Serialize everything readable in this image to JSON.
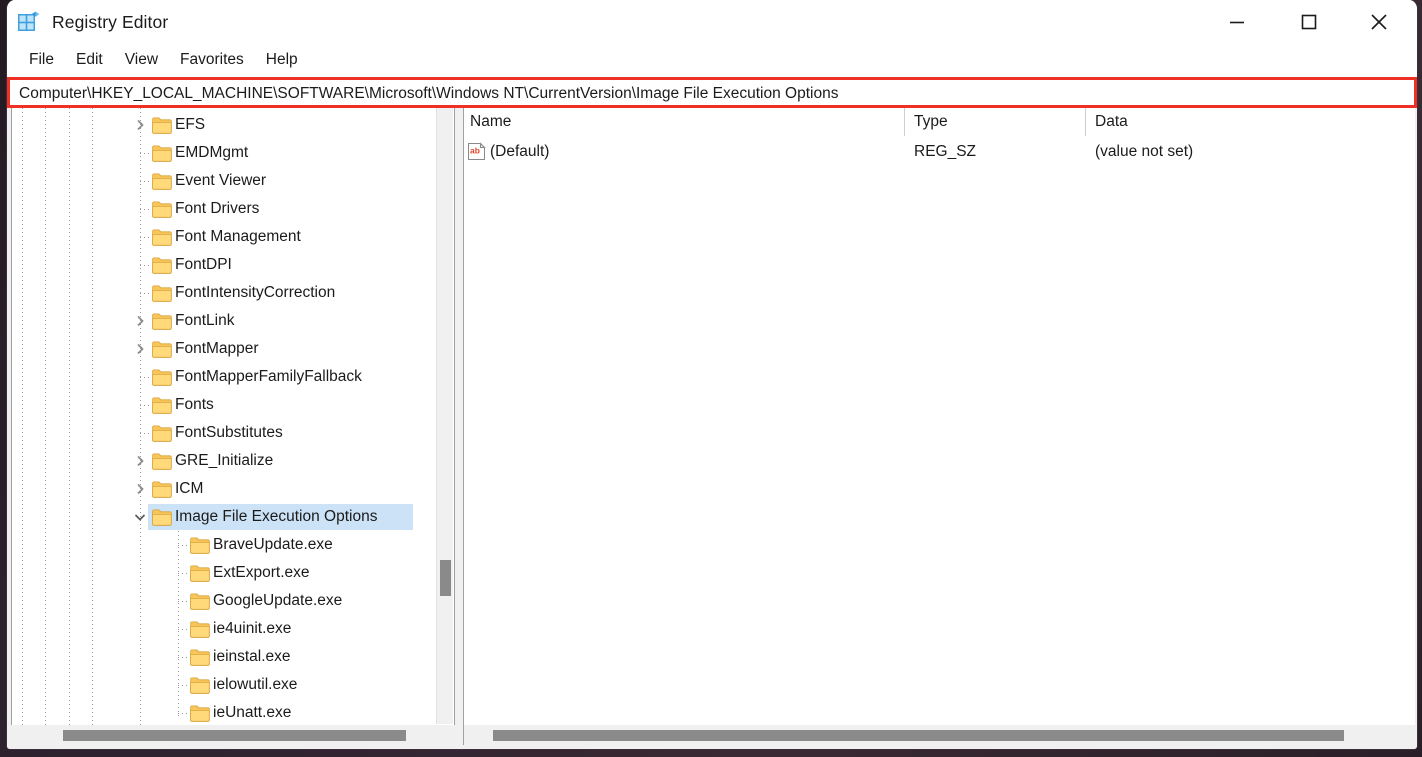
{
  "window": {
    "title": "Registry Editor",
    "icon": "registry-editor-icon",
    "controls": {
      "minimize": "minimize-icon",
      "maximize": "maximize-icon",
      "close": "close-icon"
    }
  },
  "menubar": {
    "items": [
      {
        "label": "File"
      },
      {
        "label": "Edit"
      },
      {
        "label": "View"
      },
      {
        "label": "Favorites"
      },
      {
        "label": "Help"
      }
    ]
  },
  "address": {
    "path": "Computer\\HKEY_LOCAL_MACHINE\\SOFTWARE\\Microsoft\\Windows NT\\CurrentVersion\\Image File Execution Options",
    "highlight_color": "#ee3124"
  },
  "tree": {
    "selection_color": "#cce3f7",
    "items": [
      {
        "label": "EFS",
        "depth": 1,
        "expander": "collapsed",
        "selected": false
      },
      {
        "label": "EMDMgmt",
        "depth": 1,
        "expander": "none",
        "selected": false
      },
      {
        "label": "Event Viewer",
        "depth": 1,
        "expander": "none",
        "selected": false
      },
      {
        "label": "Font Drivers",
        "depth": 1,
        "expander": "none",
        "selected": false
      },
      {
        "label": "Font Management",
        "depth": 1,
        "expander": "none",
        "selected": false
      },
      {
        "label": "FontDPI",
        "depth": 1,
        "expander": "none",
        "selected": false
      },
      {
        "label": "FontIntensityCorrection",
        "depth": 1,
        "expander": "none",
        "selected": false
      },
      {
        "label": "FontLink",
        "depth": 1,
        "expander": "collapsed",
        "selected": false
      },
      {
        "label": "FontMapper",
        "depth": 1,
        "expander": "collapsed",
        "selected": false
      },
      {
        "label": "FontMapperFamilyFallback",
        "depth": 1,
        "expander": "none",
        "selected": false
      },
      {
        "label": "Fonts",
        "depth": 1,
        "expander": "none",
        "selected": false
      },
      {
        "label": "FontSubstitutes",
        "depth": 1,
        "expander": "none",
        "selected": false
      },
      {
        "label": "GRE_Initialize",
        "depth": 1,
        "expander": "collapsed",
        "selected": false
      },
      {
        "label": "ICM",
        "depth": 1,
        "expander": "collapsed",
        "selected": false
      },
      {
        "label": "Image File Execution Options",
        "depth": 1,
        "expander": "expanded",
        "selected": true
      },
      {
        "label": "BraveUpdate.exe",
        "depth": 2,
        "expander": "none",
        "selected": false
      },
      {
        "label": "ExtExport.exe",
        "depth": 2,
        "expander": "none",
        "selected": false
      },
      {
        "label": "GoogleUpdate.exe",
        "depth": 2,
        "expander": "none",
        "selected": false
      },
      {
        "label": "ie4uinit.exe",
        "depth": 2,
        "expander": "none",
        "selected": false
      },
      {
        "label": "ieinstal.exe",
        "depth": 2,
        "expander": "none",
        "selected": false
      },
      {
        "label": "ielowutil.exe",
        "depth": 2,
        "expander": "none",
        "selected": false
      },
      {
        "label": "ieUnatt.exe",
        "depth": 2,
        "expander": "none",
        "selected": false
      }
    ]
  },
  "list": {
    "columns": [
      {
        "label": "Name"
      },
      {
        "label": "Type"
      },
      {
        "label": "Data"
      }
    ],
    "rows": [
      {
        "icon": "string-value-icon",
        "name": "(Default)",
        "type": "REG_SZ",
        "data": "(value not set)"
      }
    ]
  },
  "scrollbars": {
    "tree_vertical": "tree-vertical-scrollbar",
    "tree_horizontal": "tree-horizontal-scrollbar",
    "list_horizontal": "list-horizontal-scrollbar"
  }
}
